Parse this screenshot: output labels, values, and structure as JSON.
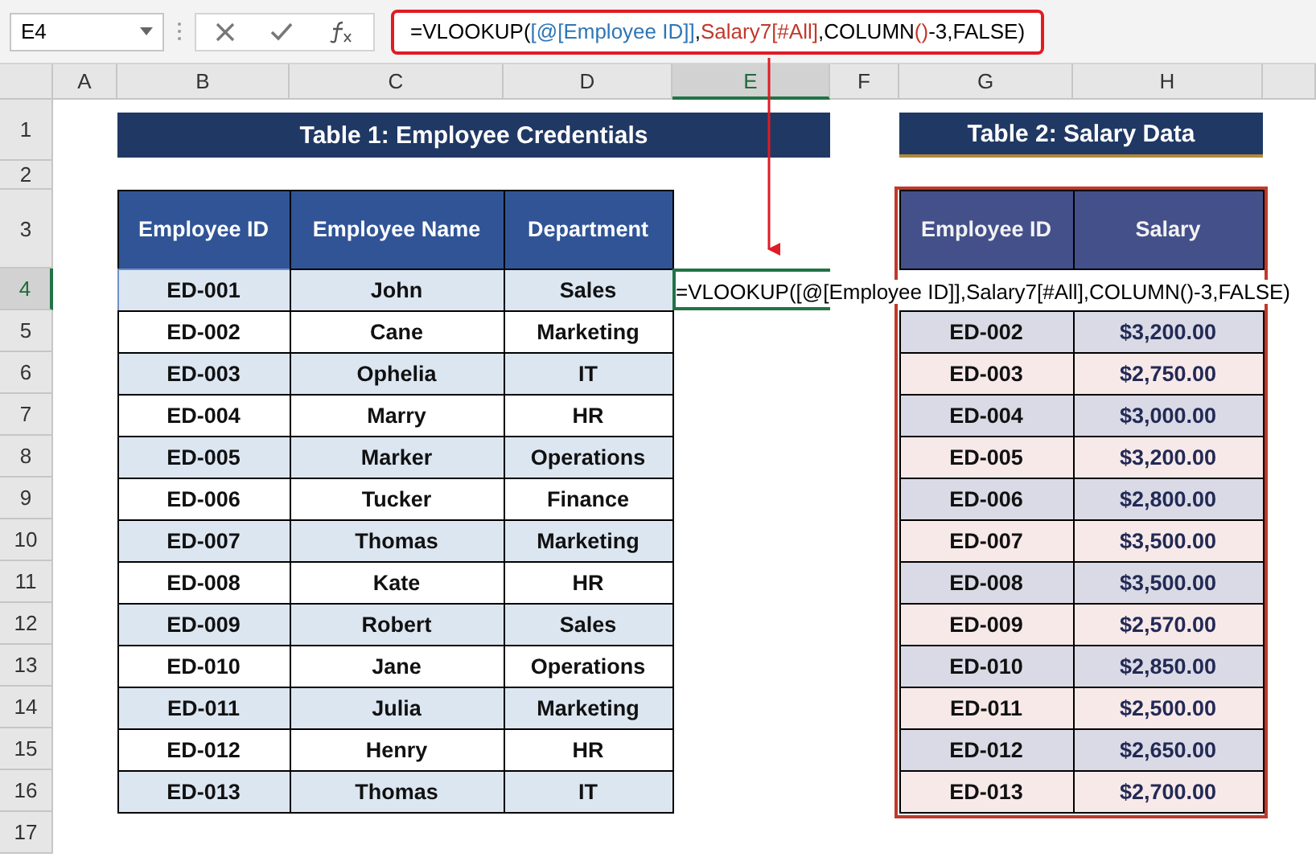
{
  "name_box": "E4",
  "formula_bar": {
    "parts": [
      {
        "lead": "=VLOOKUP(",
        "ref": "[@[Employee ID]]",
        "color": "#2e75b6"
      },
      {
        "lead": ",",
        "ref": "Salary7[#All]",
        "color": "#c0392b"
      },
      {
        "lead": ",COLUMN",
        "ref": "()",
        "color": "#c0392b"
      }
    ],
    "tail": "-3,FALSE)"
  },
  "columns": [
    {
      "label": "A",
      "selected": false
    },
    {
      "label": "B",
      "selected": false
    },
    {
      "label": "C",
      "selected": false
    },
    {
      "label": "D",
      "selected": false
    },
    {
      "label": "E",
      "selected": true
    },
    {
      "label": "F",
      "selected": false
    },
    {
      "label": "G",
      "selected": false
    },
    {
      "label": "H",
      "selected": false
    }
  ],
  "rows": [
    {
      "label": "1",
      "selected": false
    },
    {
      "label": "2",
      "selected": false
    },
    {
      "label": "3",
      "selected": false
    },
    {
      "label": "4",
      "selected": true
    },
    {
      "label": "5",
      "selected": false
    },
    {
      "label": "6",
      "selected": false
    },
    {
      "label": "7",
      "selected": false
    },
    {
      "label": "8",
      "selected": false
    },
    {
      "label": "9",
      "selected": false
    },
    {
      "label": "10",
      "selected": false
    },
    {
      "label": "11",
      "selected": false
    },
    {
      "label": "12",
      "selected": false
    },
    {
      "label": "13",
      "selected": false
    },
    {
      "label": "14",
      "selected": false
    },
    {
      "label": "15",
      "selected": false
    },
    {
      "label": "16",
      "selected": false
    },
    {
      "label": "17",
      "selected": false
    }
  ],
  "table1": {
    "title": "Table 1: Employee Credentials",
    "columns": [
      "Employee ID",
      "Employee Name",
      "Department"
    ],
    "rows": [
      [
        "ED-001",
        "John",
        "Sales"
      ],
      [
        "ED-002",
        "Cane",
        "Marketing"
      ],
      [
        "ED-003",
        "Ophelia",
        "IT"
      ],
      [
        "ED-004",
        "Marry",
        "HR"
      ],
      [
        "ED-005",
        "Marker",
        "Operations"
      ],
      [
        "ED-006",
        "Tucker",
        "Finance"
      ],
      [
        "ED-007",
        "Thomas",
        "Marketing"
      ],
      [
        "ED-008",
        "Kate",
        "HR"
      ],
      [
        "ED-009",
        "Robert",
        "Sales"
      ],
      [
        "ED-010",
        "Jane",
        "Operations"
      ],
      [
        "ED-011",
        "Julia",
        "Marketing"
      ],
      [
        "ED-012",
        "Henry",
        "HR"
      ],
      [
        "ED-013",
        "Thomas",
        "IT"
      ]
    ]
  },
  "active_cell": {
    "formula": "=VLOOKUP([@[Employee ID]],Salary7[#All],COLUMN()-3,FALSE)"
  },
  "table2": {
    "title": "Table 2: Salary Data",
    "columns": [
      "Employee ID",
      "Salary"
    ],
    "rows": [
      [
        "ED-002",
        "$3,200.00"
      ],
      [
        "ED-003",
        "$2,750.00"
      ],
      [
        "ED-004",
        "$3,000.00"
      ],
      [
        "ED-005",
        "$3,200.00"
      ],
      [
        "ED-006",
        "$2,800.00"
      ],
      [
        "ED-007",
        "$3,500.00"
      ],
      [
        "ED-008",
        "$3,500.00"
      ],
      [
        "ED-009",
        "$2,570.00"
      ],
      [
        "ED-010",
        "$2,850.00"
      ],
      [
        "ED-011",
        "$2,500.00"
      ],
      [
        "ED-012",
        "$2,650.00"
      ],
      [
        "ED-013",
        "$2,700.00"
      ]
    ]
  }
}
